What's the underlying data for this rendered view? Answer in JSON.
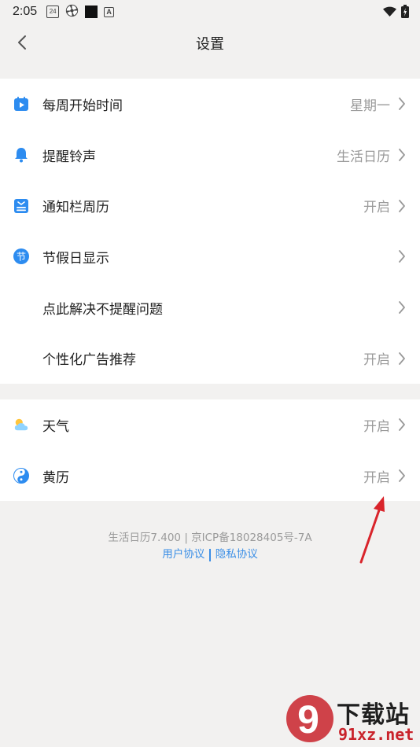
{
  "status_bar": {
    "time": "2:05",
    "calendar_day": "24",
    "a_icon": "A",
    "icons": [
      "calendar-icon",
      "pinwheel-icon",
      "black-square-icon",
      "a-box-icon",
      "wifi-icon",
      "battery-icon"
    ]
  },
  "header": {
    "title": "设置",
    "back_icon": "chevron-left-icon"
  },
  "groups": [
    {
      "rows": [
        {
          "label": "每周开始时间",
          "value": "星期一",
          "icon": "calendar-play-icon"
        },
        {
          "label": "提醒铃声",
          "value": "生活日历",
          "icon": "bell-icon"
        },
        {
          "label": "通知栏周历",
          "value": "开启",
          "icon": "notification-card-icon"
        },
        {
          "label": "节假日显示",
          "value": "",
          "icon": "holiday-badge-icon",
          "icon_text": "节"
        },
        {
          "label": "点此解决不提醒问题",
          "value": ""
        },
        {
          "label": "个性化广告推荐",
          "value": "开启"
        }
      ]
    },
    {
      "rows": [
        {
          "label": "天气",
          "value": "开启",
          "icon": "weather-icon"
        },
        {
          "label": "黄历",
          "value": "开启",
          "icon": "yin-yang-icon"
        }
      ]
    }
  ],
  "footer": {
    "version": "生活日历7.400 | 京ICP备18028405号-7A",
    "user_agreement": "用户协议",
    "privacy_policy": "隐私协议"
  },
  "colors": {
    "accent_blue": "#2d8cf0",
    "link_blue": "#3a8ee6",
    "annotation_red": "#d9242b",
    "background": "#f2f1f0"
  },
  "watermark": {
    "logo_glyph": "9",
    "text_cn": "下载站",
    "text_url": "91xz.net"
  }
}
